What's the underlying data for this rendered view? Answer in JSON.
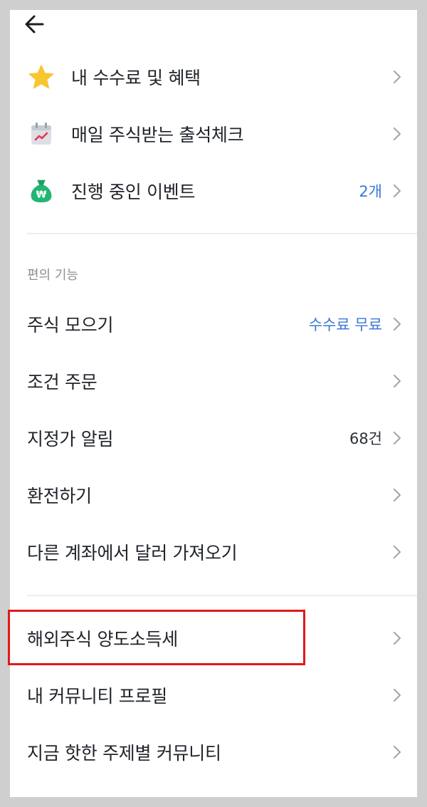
{
  "header": {
    "back_icon": "arrow-left-icon"
  },
  "top_items": [
    {
      "label": "내 수수료 및 혜택",
      "icon": "star-icon",
      "value": ""
    },
    {
      "label": "매일 주식받는 출석체크",
      "icon": "calendar-chart-icon",
      "value": ""
    },
    {
      "label": "진행 중인 이벤트",
      "icon": "money-bag-icon",
      "value": "2개"
    }
  ],
  "convenience": {
    "title": "편의 기능",
    "items": [
      {
        "label": "주식 모으기",
        "value": "수수료 무료"
      },
      {
        "label": "조건 주문",
        "value": ""
      },
      {
        "label": "지정가 알림",
        "value": "68건"
      },
      {
        "label": "환전하기",
        "value": ""
      },
      {
        "label": "다른 계좌에서 달러 가져오기",
        "value": ""
      }
    ]
  },
  "bottom_items": [
    {
      "label": "해외주식 양도소득세"
    },
    {
      "label": "내 커뮤니티 프로필"
    },
    {
      "label": "지금 핫한 주제별 커뮤니티"
    }
  ],
  "colors": {
    "accent_blue": "#3a78d4",
    "highlight_red": "#e01a1a",
    "star_yellow": "#f7c631",
    "bag_green": "#22b573"
  }
}
